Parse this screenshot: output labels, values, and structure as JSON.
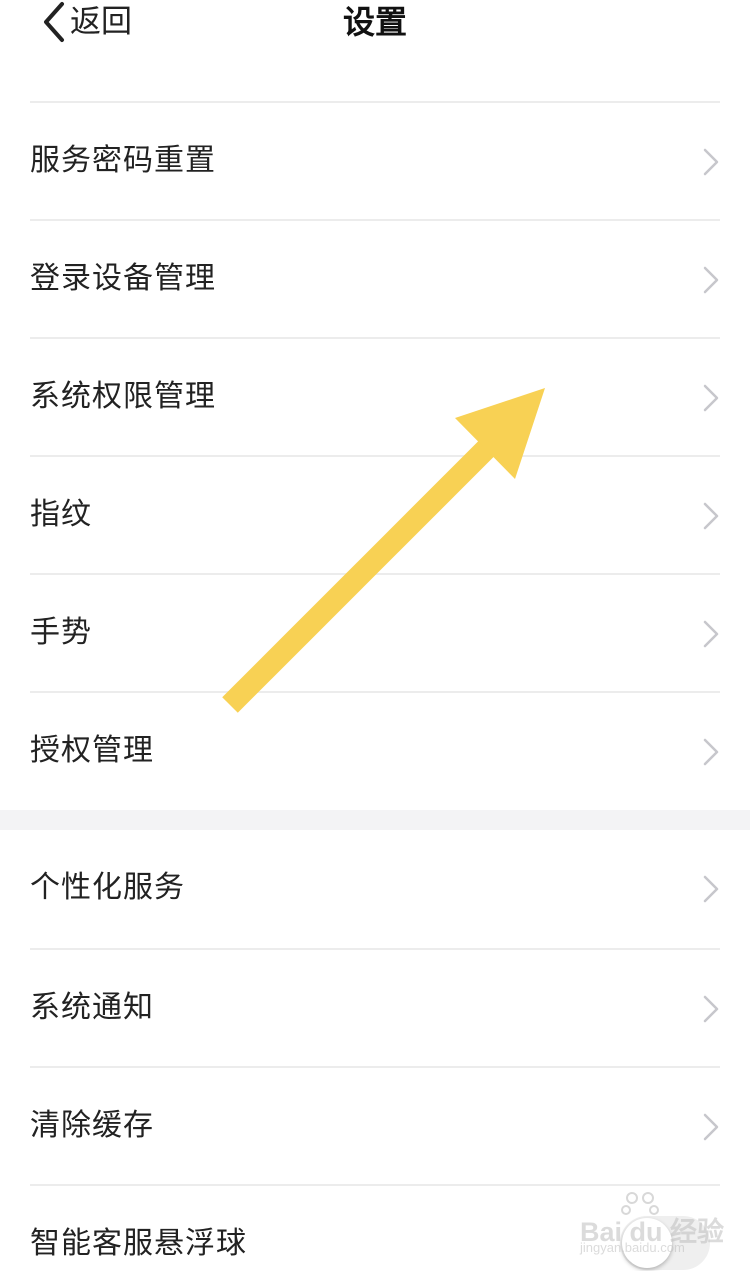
{
  "header": {
    "back_label": "返回",
    "title": "设置"
  },
  "groups": [
    {
      "items": [
        {
          "label": "服务密码重置"
        },
        {
          "label": "登录设备管理"
        },
        {
          "label": "系统权限管理"
        },
        {
          "label": "指纹"
        },
        {
          "label": "手势"
        },
        {
          "label": "授权管理"
        }
      ]
    },
    {
      "items": [
        {
          "label": "个性化服务"
        },
        {
          "label": "系统通知"
        },
        {
          "label": "清除缓存"
        },
        {
          "label": "智能客服悬浮球",
          "toggle_on": false
        }
      ]
    }
  ],
  "annotation": {
    "arrow_color": "#f8d154"
  },
  "watermark": {
    "text": "Bai du 经验",
    "sub": "jingyan.baidu.com"
  },
  "colors": {
    "divider": "#ececec",
    "section_gap": "#f3f3f5",
    "chevron": "#c7c7cc"
  }
}
